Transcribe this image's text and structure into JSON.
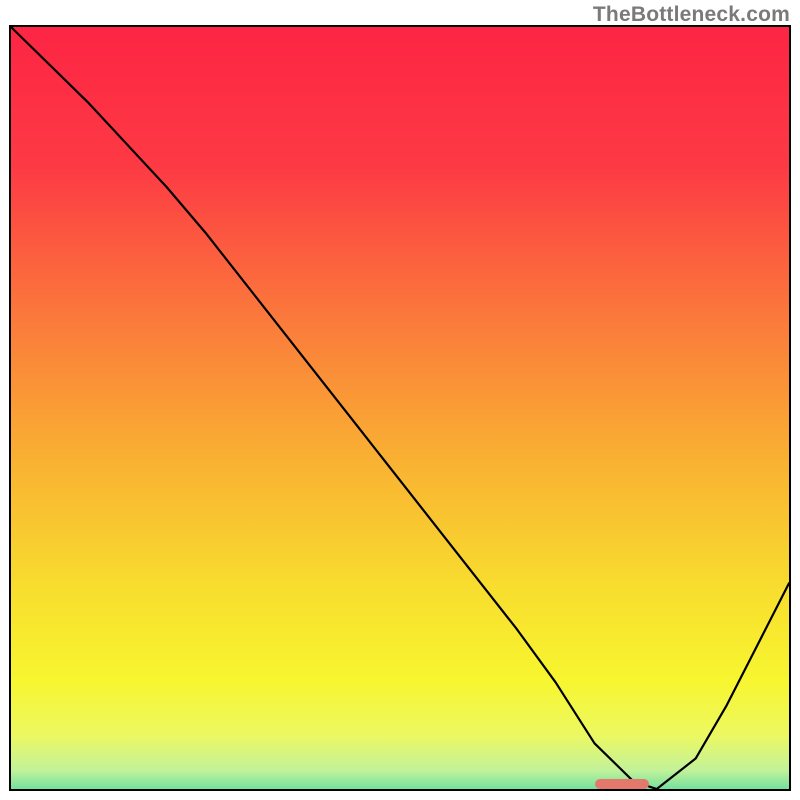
{
  "watermark": "TheBottleneck.com",
  "chart_data": {
    "type": "line",
    "title": "",
    "xlabel": "",
    "ylabel": "",
    "xlim": [
      0,
      100
    ],
    "ylim": [
      0,
      100
    ],
    "grid": false,
    "legend": false,
    "background_gradient": {
      "direction": "vertical",
      "stops": [
        {
          "pos": 0.0,
          "color": "#fd2544"
        },
        {
          "pos": 0.18,
          "color": "#fd3a44"
        },
        {
          "pos": 0.38,
          "color": "#fb7b3b"
        },
        {
          "pos": 0.56,
          "color": "#f9b232"
        },
        {
          "pos": 0.72,
          "color": "#f8dd2e"
        },
        {
          "pos": 0.84,
          "color": "#f7f62f"
        },
        {
          "pos": 0.91,
          "color": "#ecf861"
        },
        {
          "pos": 0.955,
          "color": "#c3f29a"
        },
        {
          "pos": 0.985,
          "color": "#63dd9f"
        },
        {
          "pos": 1.0,
          "color": "#17cd78"
        }
      ]
    },
    "series": [
      {
        "name": "bottleneck-curve",
        "color": "#000000",
        "x": [
          0,
          10,
          20,
          25,
          35,
          45,
          55,
          65,
          70,
          75,
          80,
          83,
          88,
          92,
          96,
          100
        ],
        "y": [
          100,
          90,
          79,
          73,
          60,
          47,
          34,
          21,
          14,
          6,
          1,
          0,
          4,
          11,
          19,
          27
        ]
      }
    ],
    "minimum_marker": {
      "x_start": 75,
      "x_end": 82,
      "y": 0,
      "color": "#e3796d"
    }
  }
}
